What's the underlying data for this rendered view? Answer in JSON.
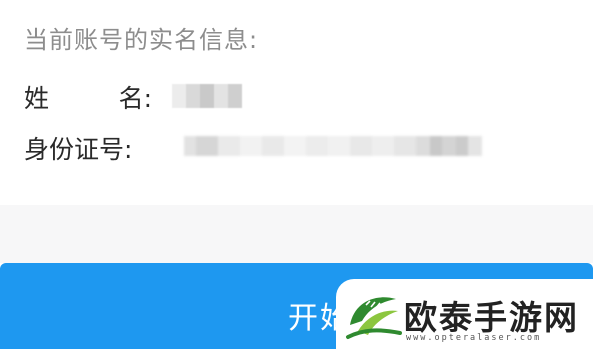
{
  "info": {
    "heading": "当前账号的实名信息:",
    "name_label_first": "姓",
    "name_label_second": "名:",
    "id_label": "身份证号:",
    "name_value_obscured": "pixelated",
    "id_value_obscured": "pixelated"
  },
  "action_button": {
    "label": "开始"
  },
  "watermark": {
    "brand": "欧泰手游网",
    "url": "www.opteralaser.com",
    "logo_icon": "leaf-swoosh-icon"
  },
  "colors": {
    "primary": "#1e98f0",
    "heading_text": "#8d8d8d",
    "label_text": "#2a2a2a",
    "logo_green": "#2f8a2f",
    "logo_light_green": "#8cc63f"
  }
}
